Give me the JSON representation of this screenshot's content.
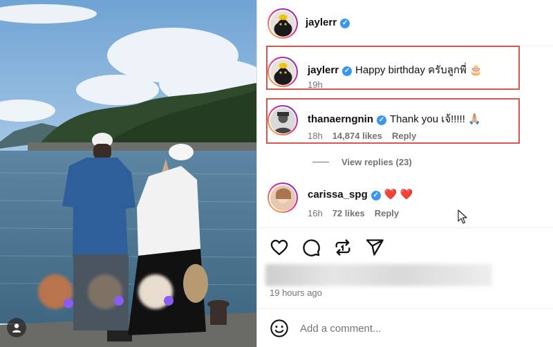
{
  "post": {
    "author": "jaylerr",
    "time_ago": "19 hours ago"
  },
  "comments": [
    {
      "username": "jaylerr",
      "text": "Happy birthday ครับลูกพี่ 🎂",
      "time": "19h",
      "likes": "",
      "reply": ""
    },
    {
      "username": "thanaerngnin",
      "text": "Thank you เจ้!!!!! 🙏🏼",
      "time": "18h",
      "likes": "14,874 likes",
      "reply": "Reply",
      "view_replies": "View replies (23)"
    },
    {
      "username": "carissa_spg",
      "text": "❤️ ❤️",
      "time": "16h",
      "likes": "72 likes",
      "reply": "Reply"
    }
  ],
  "composer": {
    "placeholder": "Add a comment..."
  },
  "icons": [
    "heart-icon",
    "comment-icon",
    "repost-icon",
    "share-icon",
    "emoji-icon",
    "user-tag-icon",
    "verified-badge-icon"
  ],
  "colors": {
    "verified": "#3897f0",
    "highlight_box": "#d9534f",
    "heart": "#ed4956",
    "muted_text": "#737373"
  }
}
